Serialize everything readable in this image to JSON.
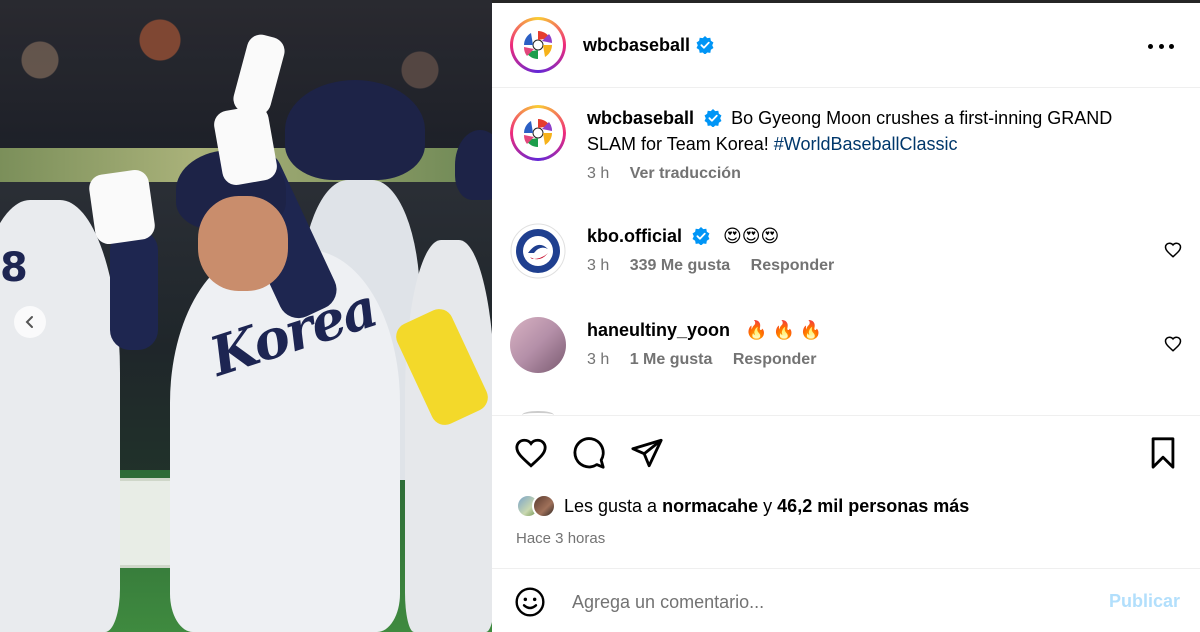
{
  "post": {
    "author": "wbcbaseball",
    "verified": true,
    "caption_text": "Bo Gyeong Moon crushes a first-inning GRAND SLAM for Team Korea!",
    "hashtag": "#WorldBaseballClassic",
    "caption_time": "3 h",
    "translate_label": "Ver traducción"
  },
  "comments": [
    {
      "username": "kbo.official",
      "verified": true,
      "text": "😍😍😍",
      "time": "3 h",
      "likes": "339 Me gusta",
      "reply": "Responder"
    },
    {
      "username": "haneultiny_yoon",
      "verified": false,
      "text": "🔥 🔥 🔥",
      "time": "3 h",
      "likes": "1 Me gusta",
      "reply": "Responder"
    }
  ],
  "engagement": {
    "likes_prefix": "Les gusta a",
    "liked_by": "normacahe",
    "likes_connector": "y",
    "others": "46,2 mil personas más",
    "posted_ago": "Hace 3 horas"
  },
  "composer": {
    "placeholder": "Agrega un comentario...",
    "publish_label": "Publicar"
  },
  "icons": {
    "header_more": "more-horizontal-icon",
    "like": "heart-icon",
    "comment": "comment-bubble-icon",
    "share": "send-icon",
    "save": "bookmark-icon",
    "emoji": "smiley-icon",
    "carousel_prev": "chevron-left-icon"
  },
  "colors": {
    "verified": "#0095f6",
    "link": "#00376b",
    "muted": "#737373",
    "publish_disabled": "#b2dffc"
  },
  "media": {
    "jersey_text": "Korea"
  }
}
